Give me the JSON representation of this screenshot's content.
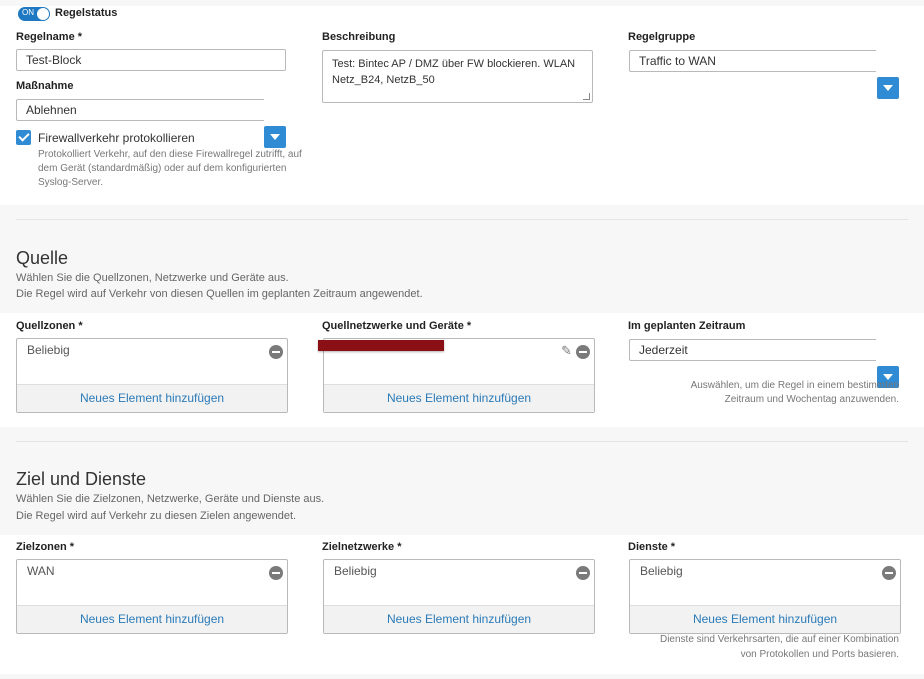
{
  "rule_status": {
    "toggle_label": "ON",
    "label": "Regelstatus"
  },
  "general": {
    "rule_name": {
      "label": "Regelname *",
      "value": "Test-Block"
    },
    "action": {
      "label": "Maßnahme",
      "value": "Ablehnen"
    },
    "log_firewall": {
      "label": "Firewallverkehr protokollieren",
      "checked": true,
      "description": "Protokolliert Verkehr, auf den diese Firewallregel zutrifft, auf dem Gerät (standardmäßig) oder auf dem konfigurierten Syslog-Server."
    },
    "description": {
      "label": "Beschreibung",
      "value": "Test: Bintec AP / DMZ über FW blockieren. WLAN Netz_B24, NetzB_50"
    },
    "rule_group": {
      "label": "Regelgruppe",
      "value": "Traffic to WAN"
    }
  },
  "source": {
    "title": "Quelle",
    "subtitle_1": "Wählen Sie die Quellzonen, Netzwerke und Geräte aus.",
    "subtitle_2": "Die Regel wird auf Verkehr von diesen Quellen im geplanten Zeitraum angewendet.",
    "zones": {
      "label": "Quellzonen *",
      "value": "Beliebig",
      "add_label": "Neues Element hinzufügen"
    },
    "networks": {
      "label": "Quellnetzwerke und Geräte *",
      "add_label": "Neues Element hinzufügen"
    },
    "schedule": {
      "label": "Im geplanten Zeitraum",
      "value": "Jederzeit",
      "help_1": "Auswählen, um die Regel in einem bestimmten",
      "help_2": "Zeitraum und Wochentag anzuwenden."
    }
  },
  "destination": {
    "title": "Ziel und Dienste",
    "subtitle_1": "Wählen Sie die Zielzonen, Netzwerke, Geräte und Dienste aus.",
    "subtitle_2": "Die Regel wird auf Verkehr zu diesen Zielen angewendet.",
    "zones": {
      "label": "Zielzonen *",
      "value": "WAN",
      "add_label": "Neues Element hinzufügen"
    },
    "networks": {
      "label": "Zielnetzwerke *",
      "value": "Beliebig",
      "add_label": "Neues Element hinzufügen"
    },
    "services": {
      "label": "Dienste *",
      "value": "Beliebig",
      "add_label": "Neues Element hinzufügen",
      "help_1": "Dienste sind Verkehrsarten, die auf einer Kombination",
      "help_2": "von Protokollen und Ports basieren."
    }
  },
  "colors": {
    "accent": "#2f8bd3",
    "link": "#2a7ab8",
    "redaction": "#8b1015"
  }
}
